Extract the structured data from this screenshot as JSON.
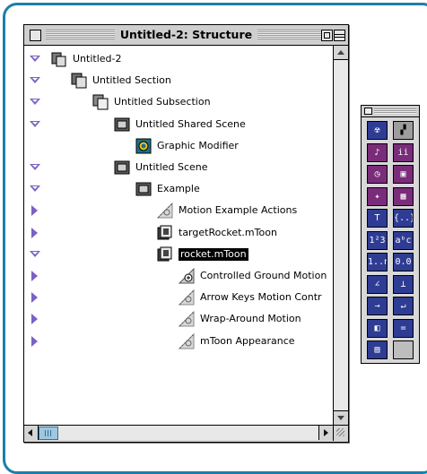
{
  "window": {
    "title": "Untitled-2: Structure"
  },
  "tree": [
    {
      "label": "Untitled-2",
      "expander": "down",
      "icon": "project-icon"
    },
    {
      "label": "Untitled Section",
      "expander": "down",
      "icon": "section-icon"
    },
    {
      "label": "Untitled Subsection",
      "expander": "down",
      "icon": "subsection-icon"
    },
    {
      "label": "Untitled Shared Scene",
      "expander": "down",
      "icon": "scene-icon"
    },
    {
      "label": "Graphic Modifier",
      "expander": "none",
      "icon": "graphic-modifier-icon"
    },
    {
      "label": "Untitled Scene",
      "expander": "down",
      "icon": "scene-icon"
    },
    {
      "label": "Example",
      "expander": "down",
      "icon": "scene-icon"
    },
    {
      "label": "Motion Example Actions",
      "expander": "right",
      "icon": "alias-icon"
    },
    {
      "label": "targetRocket.mToon",
      "expander": "right",
      "icon": "mtoon-icon"
    },
    {
      "label": "rocket.mToon",
      "expander": "down",
      "icon": "mtoon-icon",
      "selected": true
    },
    {
      "label": "Controlled Ground Motion",
      "expander": "right",
      "icon": "motion-modifier-icon"
    },
    {
      "label": "Arrow Keys Motion Contr",
      "expander": "right",
      "icon": "alias-icon"
    },
    {
      "label": "Wrap-Around Motion",
      "expander": "right",
      "icon": "alias-icon"
    },
    {
      "label": "mToon Appearance",
      "expander": "right",
      "icon": "alias-icon"
    }
  ],
  "palette": {
    "tools": [
      {
        "name": "messenger-tool-icon",
        "glyph": "☢",
        "color": "blue"
      },
      {
        "name": "scene-change-tool-icon",
        "glyph": "▞",
        "color": "gray"
      },
      {
        "name": "sound-tool-icon",
        "glyph": "♪",
        "color": "purple"
      },
      {
        "name": "miniscript-tool-icon",
        "glyph": "ii",
        "color": "purple"
      },
      {
        "name": "timer-tool-icon",
        "glyph": "◷",
        "color": "purple"
      },
      {
        "name": "boundary-tool-icon",
        "glyph": "▣",
        "color": "purple"
      },
      {
        "name": "vector-motion-tool-icon",
        "glyph": "✦",
        "color": "purple"
      },
      {
        "name": "keyboard-tool-icon",
        "glyph": "▦",
        "color": "purple"
      },
      {
        "name": "text-style-tool-icon",
        "glyph": "T",
        "color": "blue"
      },
      {
        "name": "set-tool-icon",
        "glyph": "{..}",
        "color": "blue"
      },
      {
        "name": "integer-tool-icon",
        "glyph": "1²3",
        "color": "blue"
      },
      {
        "name": "string-tool-icon",
        "glyph": "aᵇc",
        "color": "blue"
      },
      {
        "name": "range-tool-icon",
        "glyph": "1..n",
        "color": "blue"
      },
      {
        "name": "float-tool-icon",
        "glyph": "0.0",
        "color": "blue"
      },
      {
        "name": "vector-tool-icon",
        "glyph": "∠",
        "color": "blue"
      },
      {
        "name": "point-tool-icon",
        "glyph": "⊥",
        "color": "blue"
      },
      {
        "name": "arrow-tool-icon",
        "glyph": "→",
        "color": "blue"
      },
      {
        "name": "return-tool-icon",
        "glyph": "↵",
        "color": "blue"
      },
      {
        "name": "graphic-tool-icon",
        "glyph": "◧",
        "color": "blue"
      },
      {
        "name": "equals-tool-icon",
        "glyph": "=",
        "color": "blue"
      },
      {
        "name": "save-tool-icon",
        "glyph": "▤",
        "color": "blue"
      },
      {
        "name": "empty-slot",
        "glyph": "",
        "color": "empty"
      }
    ]
  }
}
